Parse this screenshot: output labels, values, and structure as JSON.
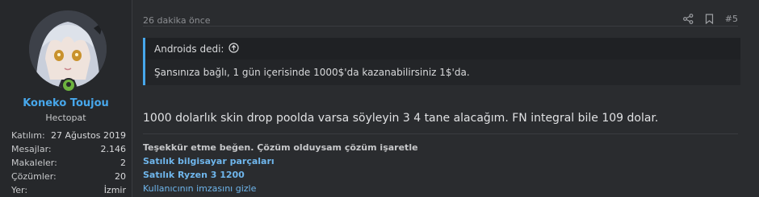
{
  "user": {
    "name": "Koneko Toujou",
    "title": "Hectopat",
    "stats": [
      {
        "label": "Katılım:",
        "value": "27 Ağustos 2019"
      },
      {
        "label": "Mesajlar:",
        "value": "2.146"
      },
      {
        "label": "Makaleler:",
        "value": "2"
      },
      {
        "label": "Çözümler:",
        "value": "20"
      },
      {
        "label": "Yer:",
        "value": "İzmir"
      }
    ]
  },
  "post": {
    "time": "26 dakika önce",
    "number": "#5",
    "quote": {
      "author": "Androids dedi:",
      "text": "Şansınıza bağlı, 1 gün içerisinde 1000$'da kazanabilirsiniz 1$'da."
    },
    "message": "1000 dolarlık skin drop poolda varsa söyleyin 3 4 tane alacağım. FN integral bile 109 dolar."
  },
  "signature": {
    "line1": "Teşekkür etme beğen. Çözüm olduysam çözüm işaretle",
    "link1": "Satılık bilgisayar parçaları",
    "link2": "Satılık Ryzen 3 1200",
    "toggle": "Kullanıcının imzasını gizle"
  },
  "colors": {
    "accent": "#47a7eb",
    "online": "#6db33f",
    "background": "#2a2c2f"
  }
}
